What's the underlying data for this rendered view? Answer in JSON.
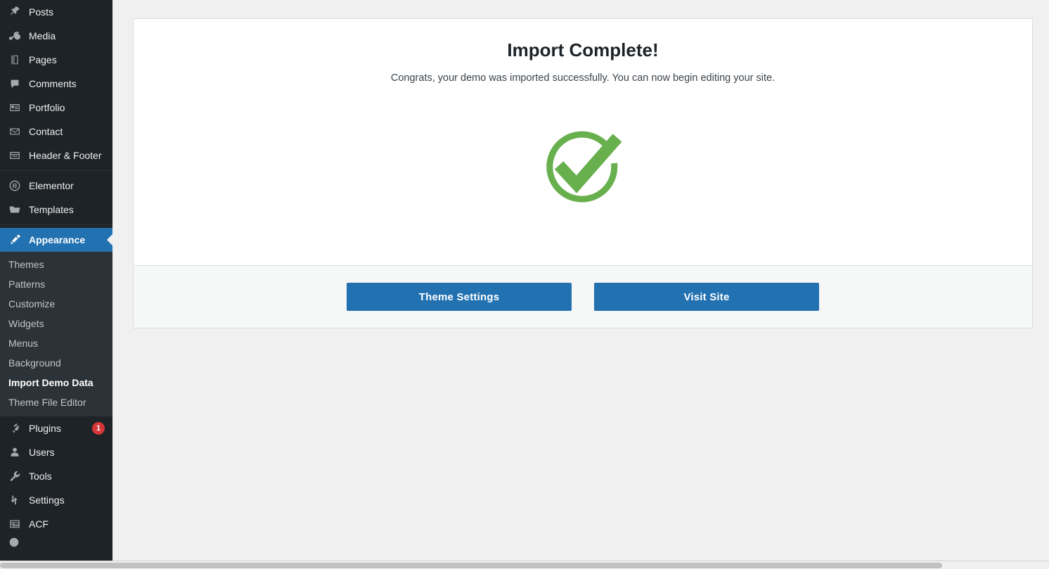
{
  "sidebar": {
    "items": [
      {
        "label": "Posts",
        "icon": "pin-icon",
        "current": false
      },
      {
        "label": "Media",
        "icon": "media-icon",
        "current": false
      },
      {
        "label": "Pages",
        "icon": "pages-icon",
        "current": false
      },
      {
        "label": "Comments",
        "icon": "comments-icon",
        "current": false
      },
      {
        "label": "Portfolio",
        "icon": "portfolio-icon",
        "current": false
      },
      {
        "label": "Contact",
        "icon": "envelope-icon",
        "current": false
      },
      {
        "label": "Header & Footer",
        "icon": "header-footer-icon",
        "current": false
      },
      {
        "label": "Elementor",
        "icon": "elementor-icon",
        "current": false
      },
      {
        "label": "Templates",
        "icon": "folder-icon",
        "current": false
      },
      {
        "label": "Appearance",
        "icon": "paintbrush-icon",
        "current": true
      }
    ],
    "submenu": {
      "parent": "Appearance",
      "items": [
        {
          "label": "Themes",
          "current": false
        },
        {
          "label": "Patterns",
          "current": false
        },
        {
          "label": "Customize",
          "current": false
        },
        {
          "label": "Widgets",
          "current": false
        },
        {
          "label": "Menus",
          "current": false
        },
        {
          "label": "Background",
          "current": false
        },
        {
          "label": "Import Demo Data",
          "current": true
        },
        {
          "label": "Theme File Editor",
          "current": false
        }
      ]
    },
    "items_after": [
      {
        "label": "Plugins",
        "icon": "plug-icon",
        "badge": "1"
      },
      {
        "label": "Users",
        "icon": "user-icon",
        "badge": ""
      },
      {
        "label": "Tools",
        "icon": "wrench-icon",
        "badge": ""
      },
      {
        "label": "Settings",
        "icon": "sliders-icon",
        "badge": ""
      },
      {
        "label": "ACF",
        "icon": "grid-table-icon",
        "badge": ""
      }
    ]
  },
  "main": {
    "title": "Import Complete!",
    "subtitle": "Congrats, your demo was imported successfully. You can now begin editing your site.",
    "status_icon": "green-check-circle-icon",
    "buttons": [
      {
        "label": "Theme Settings"
      },
      {
        "label": "Visit Site"
      }
    ]
  },
  "colors": {
    "accent_blue": "#2271b1",
    "success_green": "#68b04d",
    "badge_red": "#d63638",
    "sidebar_bg": "#1d2327",
    "submenu_bg": "#2c3338"
  }
}
